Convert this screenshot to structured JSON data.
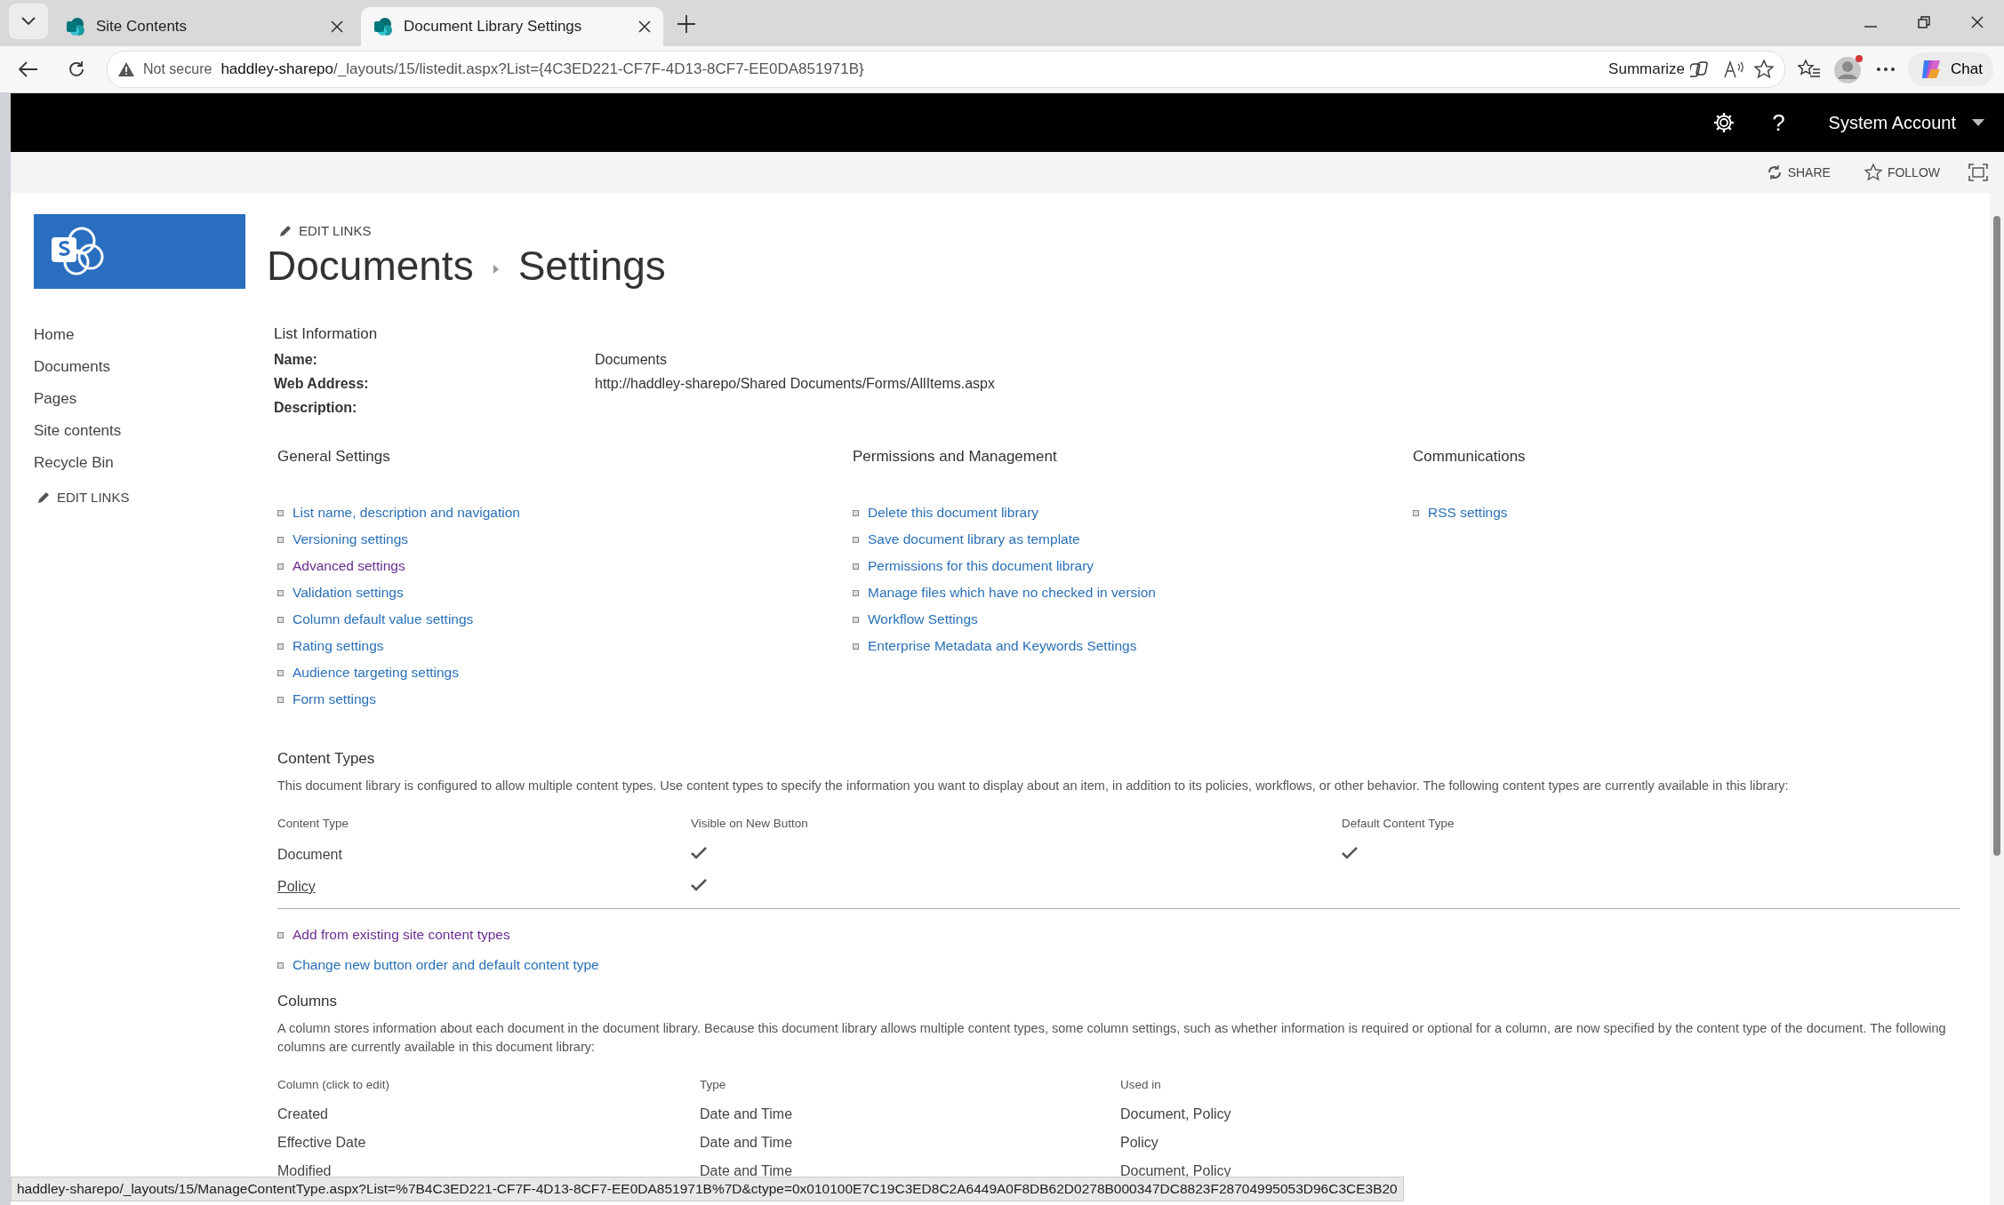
{
  "browser": {
    "tabs": [
      {
        "title": "Site Contents",
        "selected": false
      },
      {
        "title": "Document Library Settings",
        "selected": true
      }
    ],
    "address": {
      "security": "Not secure",
      "host": "haddley-sharepo",
      "path": "/_layouts/15/listedit.aspx?List={4C3ED221-CF7F-4D13-8CF7-EE0DA851971B}"
    },
    "summarize": "Summarize",
    "chat": "Chat"
  },
  "suite_bar": {
    "help": "?",
    "account": "System Account"
  },
  "ribbon": {
    "actions": [
      {
        "kind": "share",
        "label": "SHARE"
      },
      {
        "kind": "follow",
        "label": "FOLLOW"
      }
    ]
  },
  "top_edit_links": "EDIT LINKS",
  "breadcrumb": [
    "Documents",
    "Settings"
  ],
  "sidebar": {
    "items": [
      "Home",
      "Documents",
      "Pages",
      "Site contents",
      "Recycle Bin"
    ],
    "edit_links": "EDIT LINKS"
  },
  "list_information": {
    "title": "List Information",
    "fields": [
      {
        "label": "Name:",
        "value": "Documents"
      },
      {
        "label": "Web Address:",
        "value": "http://haddley-sharepo/Shared Documents/Forms/AllItems.aspx"
      },
      {
        "label": "Description:"
      }
    ]
  },
  "sections": [
    {
      "title": "General Settings",
      "links": [
        {
          "label": "List name, description and navigation",
          "visited": false
        },
        {
          "label": "Versioning settings",
          "visited": false
        },
        {
          "label": "Advanced settings",
          "visited": true
        },
        {
          "label": "Validation settings",
          "visited": false
        },
        {
          "label": "Column default value settings",
          "visited": false
        },
        {
          "label": "Rating settings",
          "visited": false
        },
        {
          "label": "Audience targeting settings",
          "visited": false
        },
        {
          "label": "Form settings",
          "visited": false
        }
      ]
    },
    {
      "title": "Permissions and Management",
      "links": [
        {
          "label": "Delete this document library",
          "visited": false
        },
        {
          "label": "Save document library as template",
          "visited": false
        },
        {
          "label": "Permissions for this document library",
          "visited": false
        },
        {
          "label": "Manage files which have no checked in version",
          "visited": false
        },
        {
          "label": "Workflow Settings",
          "visited": false
        },
        {
          "label": "Enterprise Metadata and Keywords Settings",
          "visited": false
        }
      ]
    },
    {
      "title": "Communications",
      "links": [
        {
          "label": "RSS settings",
          "visited": false
        }
      ]
    }
  ],
  "content_types": {
    "title": "Content Types",
    "description": "This document library is configured to allow multiple content types. Use content types to specify the information you want to display about an item, in addition to its policies, workflows, or other behavior. The following content types are currently available in this library:",
    "columns": [
      "Content Type",
      "Visible on New Button",
      "Default Content Type"
    ],
    "rows": [
      {
        "name": "Document",
        "link": false,
        "visible_on_new": true,
        "default": true
      },
      {
        "name": "Policy",
        "link": true,
        "visible_on_new": true,
        "default": false
      }
    ],
    "links": [
      {
        "label": "Add from existing site content types",
        "visited": true
      },
      {
        "label": "Change new button order and default content type",
        "visited": false
      }
    ]
  },
  "columns": {
    "title": "Columns",
    "description": "A column stores information about each document in the document library. Because this document library allows multiple content types, some column settings, such as whether information is required or optional for a column, are now specified by the content type of the document. The following columns are currently available in this document library:",
    "headers": [
      "Column (click to edit)",
      "Type",
      "Used in"
    ],
    "rows": [
      [
        "Created",
        "Date and Time",
        "Document, Policy"
      ],
      [
        "Effective Date",
        "Date and Time",
        "Policy"
      ],
      [
        "Modified",
        "Date and Time",
        "Document, Policy"
      ]
    ]
  },
  "status_bar": "haddley-sharepo/_layouts/15/ManageContentType.aspx?List=%7B4C3ED221-CF7F-4D13-8CF7-EE0DA851971B%7D&ctype=0x010100E7C19C3ED8C2A6449A0F8DB62D0278B000347DC8823F28704995053D96C3CE3B20"
}
